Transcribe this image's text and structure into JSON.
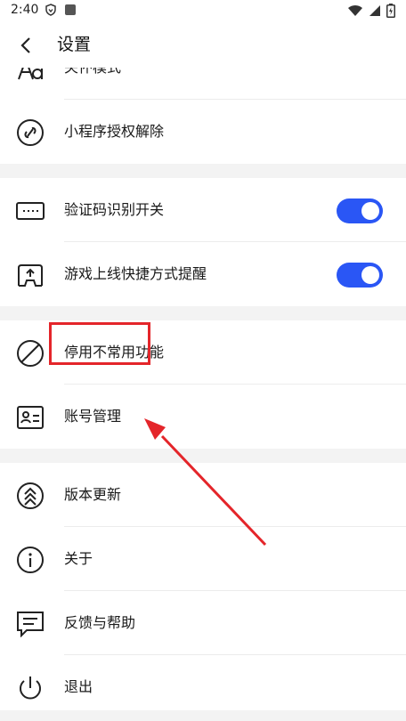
{
  "status_bar": {
    "time": "2:40"
  },
  "header": {
    "title": "设置"
  },
  "sections": [
    {
      "items": [
        {
          "label": "关怀模式",
          "icon": "font-size-icon"
        },
        {
          "label": "小程序授权解除",
          "icon": "link-icon"
        }
      ]
    },
    {
      "items": [
        {
          "label": "验证码识别开关",
          "icon": "keyboard-icon",
          "toggle": true
        },
        {
          "label": "游戏上线快捷方式提醒",
          "icon": "game-shortcut-icon",
          "toggle": true
        }
      ]
    },
    {
      "items": [
        {
          "label": "停用不常用功能",
          "icon": "prohibited-icon"
        },
        {
          "label": "账号管理",
          "icon": "id-card-icon"
        }
      ]
    },
    {
      "items": [
        {
          "label": "版本更新",
          "icon": "update-icon"
        },
        {
          "label": "关于",
          "icon": "info-icon"
        },
        {
          "label": "反馈与帮助",
          "icon": "feedback-icon"
        },
        {
          "label": "退出",
          "icon": "power-icon"
        }
      ]
    }
  ],
  "colors": {
    "toggle_on": "#2a56f5",
    "annotation": "#e4252a",
    "section_gap": "#f3f3f3"
  }
}
